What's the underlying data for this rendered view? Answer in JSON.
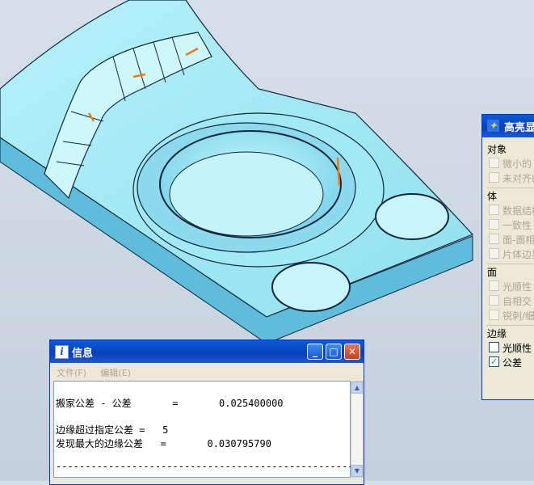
{
  "info_window": {
    "title": "信息",
    "menu": [
      "文件(F)",
      "编辑(E)"
    ],
    "lines": [
      "搬家公差 - 公差       =       0.025400000",
      "",
      "边缘超过指定公差 =   5",
      "发现最大的边缘公差   =       0.030795790",
      "",
      "---------------------------------------------------"
    ],
    "controls": {
      "minimize": "_",
      "maximize": "□",
      "close": "✕"
    }
  },
  "highlight_panel": {
    "title": "高亮显",
    "groups": [
      {
        "label": "对象",
        "items": [
          {
            "label": "微小的",
            "checked": false,
            "enabled": false
          },
          {
            "label": "未对齐的",
            "checked": false,
            "enabled": false
          }
        ]
      },
      {
        "label": "体",
        "items": [
          {
            "label": "数据结构",
            "checked": false,
            "enabled": false
          },
          {
            "label": "一致性",
            "checked": false,
            "enabled": false
          },
          {
            "label": "面-面相",
            "checked": false,
            "enabled": false
          },
          {
            "label": "片体边界",
            "checked": false,
            "enabled": false
          }
        ]
      },
      {
        "label": "面",
        "items": [
          {
            "label": "光顺性",
            "checked": false,
            "enabled": false
          },
          {
            "label": "自相交",
            "checked": false,
            "enabled": false
          },
          {
            "label": "锐刺/细",
            "checked": false,
            "enabled": false
          }
        ]
      },
      {
        "label": "边缘",
        "items": [
          {
            "label": "光顺性",
            "checked": false,
            "enabled": true
          },
          {
            "label": "公差",
            "checked": true,
            "enabled": true
          }
        ]
      }
    ]
  },
  "colors": {
    "model_face": "#a6ecf6",
    "model_side": "#6fc8e3",
    "edge_line": "#10263a",
    "error_mark": "#f07a10",
    "titlebar": "#0a4fd0"
  }
}
